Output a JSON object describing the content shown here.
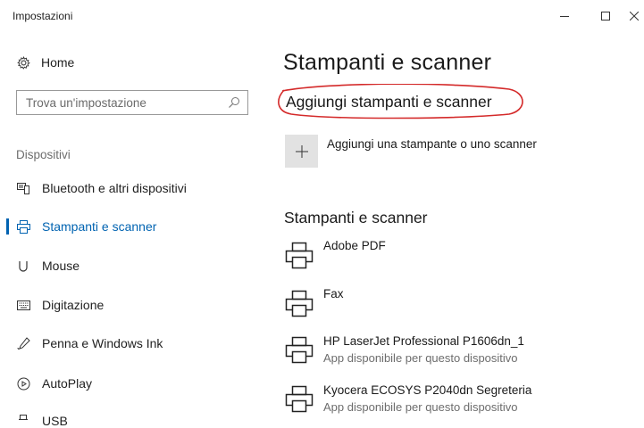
{
  "window": {
    "title": "Impostazioni",
    "minimize_icon": "minimize-icon",
    "maximize_icon": "maximize-icon",
    "close_icon": "close-icon"
  },
  "sidebar": {
    "home_label": "Home",
    "search_placeholder": "Trova un'impostazione",
    "section_label": "Dispositivi",
    "items": [
      {
        "label": "Bluetooth e altri dispositivi",
        "icon": "bluetooth-devices-icon"
      },
      {
        "label": "Stampanti e scanner",
        "icon": "printer-icon",
        "selected": true
      },
      {
        "label": "Mouse",
        "icon": "mouse-icon"
      },
      {
        "label": "Digitazione",
        "icon": "keyboard-icon"
      },
      {
        "label": "Penna e Windows Ink",
        "icon": "pen-icon"
      },
      {
        "label": "AutoPlay",
        "icon": "autoplay-icon"
      },
      {
        "label": "USB",
        "icon": "usb-icon"
      }
    ],
    "accent_color": "#0063b1"
  },
  "main": {
    "title": "Stampanti e scanner",
    "add_section_heading": "Aggiungi stampanti e scanner",
    "add_button_label": "Aggiungi una stampante o uno scanner",
    "list_heading": "Stampanti e scanner",
    "printers": [
      {
        "name": "Adobe PDF",
        "status": ""
      },
      {
        "name": "Fax",
        "status": ""
      },
      {
        "name": "HP LaserJet Professional P1606dn_1",
        "status": "App disponibile per questo dispositivo"
      },
      {
        "name": "Kyocera ECOSYS P2040dn Segreteria",
        "status": "App disponibile per questo dispositivo"
      }
    ],
    "annotation_color": "#d42a2a"
  }
}
